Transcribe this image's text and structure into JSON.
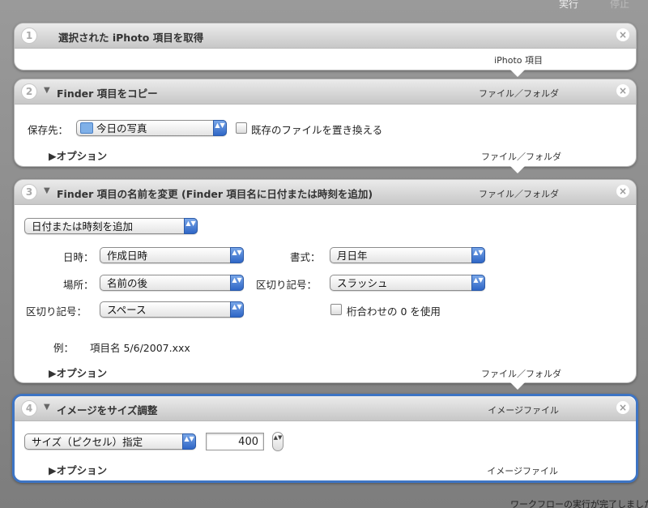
{
  "toolbar": {
    "run_label": "実行",
    "stop_label": "停止"
  },
  "status_text": "ワークフローの実行が完了しました",
  "actions": [
    {
      "number": "1",
      "title": "選択された iPhoto 項目を取得",
      "output_type": "iPhoto 項目"
    },
    {
      "number": "2",
      "title": "Finder 項目をコピー",
      "input_type": "ファイル／フォルダ",
      "output_type": "ファイル／フォルダ",
      "destination_label": "保存先：",
      "destination_value": "今日の写真",
      "replace_label": "既存のファイルを置き換える",
      "options_label": "▶オプション"
    },
    {
      "number": "3",
      "title": "Finder 項目の名前を変更 (Finder 項目名に日付または時刻を追加)",
      "input_type": "ファイル／フォルダ",
      "output_type": "ファイル／フォルダ",
      "mode_value": "日付または時刻を追加",
      "date_label": "日時：",
      "date_value": "作成日時",
      "format_label": "書式：",
      "format_value": "月日年",
      "where_label": "場所：",
      "where_value": "名前の後",
      "separator_label": "区切り記号：",
      "separator_value": "スラッシュ",
      "separator2_label": "区切り記号：",
      "separator2_value": "スペース",
      "zero_label": "桁合わせの 0 を使用",
      "example_label": "例：",
      "example_value": "項目名 5/6/2007.xxx",
      "options_label": "▶オプション"
    },
    {
      "number": "4",
      "title": "イメージをサイズ調整",
      "input_type": "イメージファイル",
      "output_type": "イメージファイル",
      "size_mode_value": "サイズ（ピクセル）指定",
      "size_value": "400",
      "options_label": "▶オプション"
    }
  ],
  "icons": {
    "close": "×",
    "disclosure": "▼",
    "popup_arrows": "▲▼"
  }
}
